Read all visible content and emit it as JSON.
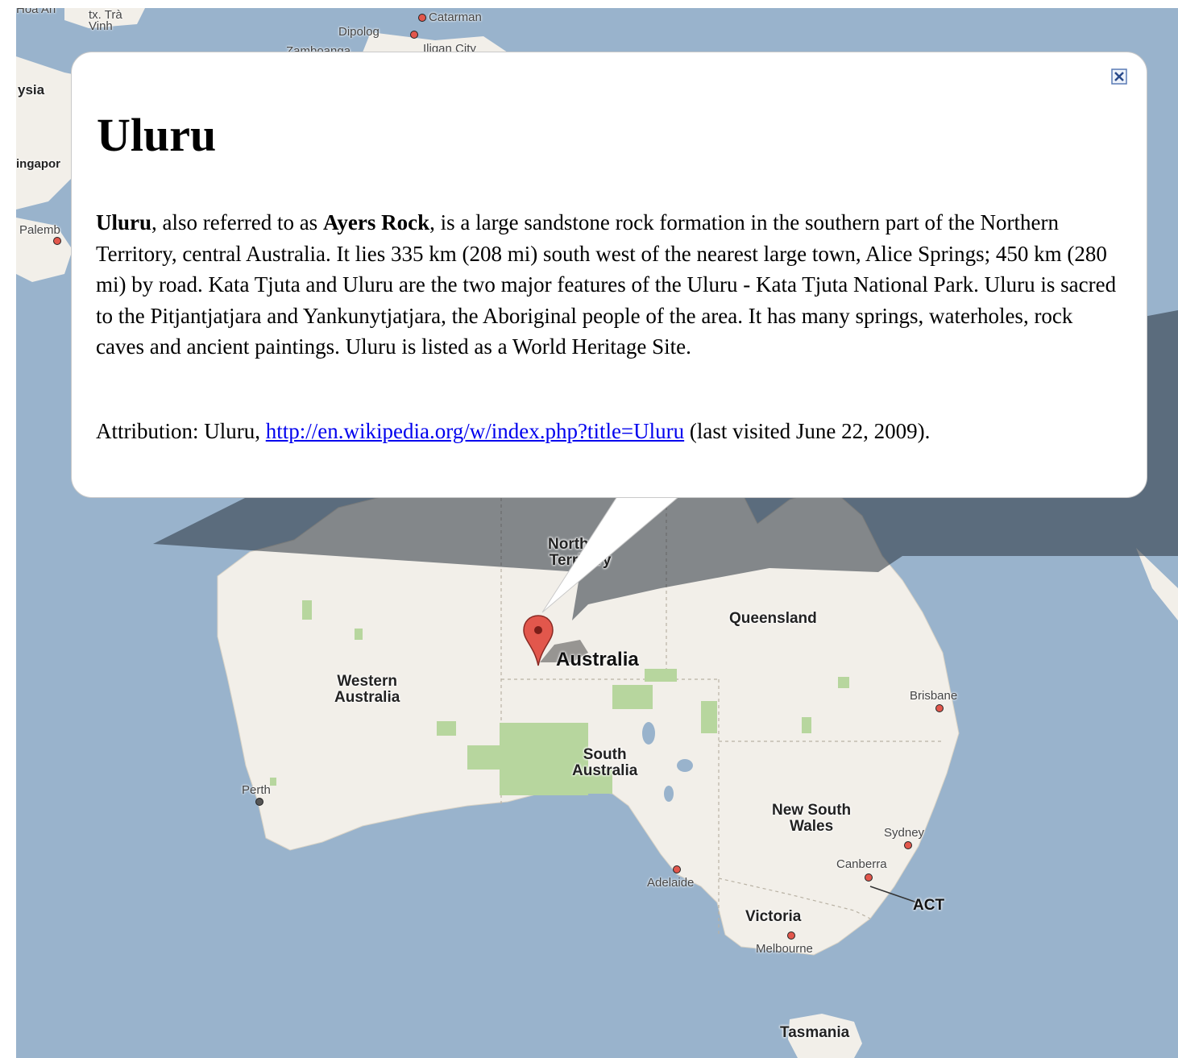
{
  "map": {
    "country_label": "Australia",
    "regions": {
      "western_australia": "Western\nAustralia",
      "northern_territory": "Northern\nTerritory",
      "queensland": "Queensland",
      "south_australia": "South\nAustralia",
      "new_south_wales": "New South\nWales",
      "victoria": "Victoria",
      "tasmania": "Tasmania",
      "act": "ACT"
    },
    "cities": {
      "perth": "Perth",
      "adelaide": "Adelaide",
      "melbourne": "Melbourne",
      "canberra": "Canberra",
      "sydney": "Sydney",
      "brisbane": "Brisbane",
      "catarman": "Catarman",
      "dipolog": "Dipolog",
      "iligan": "Iligan City",
      "zamboanga": "Zamboanga",
      "palembang": "Palemb",
      "singapore": "ingapor",
      "malaysia": "ysia",
      "hoa_an": "Hoa An",
      "tra_vinh": "tx. Trà\nVinh"
    },
    "colors": {
      "water": "#99b3cc",
      "land": "#f2efe9",
      "park": "#b7d69e",
      "marker": "#e2574c"
    },
    "marker_icon": "map-pin-icon"
  },
  "infowindow": {
    "title": "Uluru",
    "body": {
      "b1": "Uluru",
      "t1": ", also referred to as ",
      "b2": "Ayers Rock",
      "t2": ", is a large sandstone rock formation in the southern part of the Northern Territory, central Australia. It lies 335 km (208 mi) south west of the nearest large town, Alice Springs; 450 km (280 mi) by road. Kata Tjuta and Uluru are the two major features of the Uluru - Kata Tjuta National Park. Uluru is sacred to the Pitjantjatjara and Yankunytjatjara, the Aboriginal people of the area. It has many springs, waterholes, rock caves and ancient paintings. Uluru is listed as a World Heritage Site."
    },
    "attribution_prefix": "Attribution: Uluru, ",
    "attribution_link": "http://en.wikipedia.org/w/index.php?title=Uluru",
    "attribution_suffix": " (last visited June 22, 2009).",
    "close_icon": "close-icon"
  }
}
